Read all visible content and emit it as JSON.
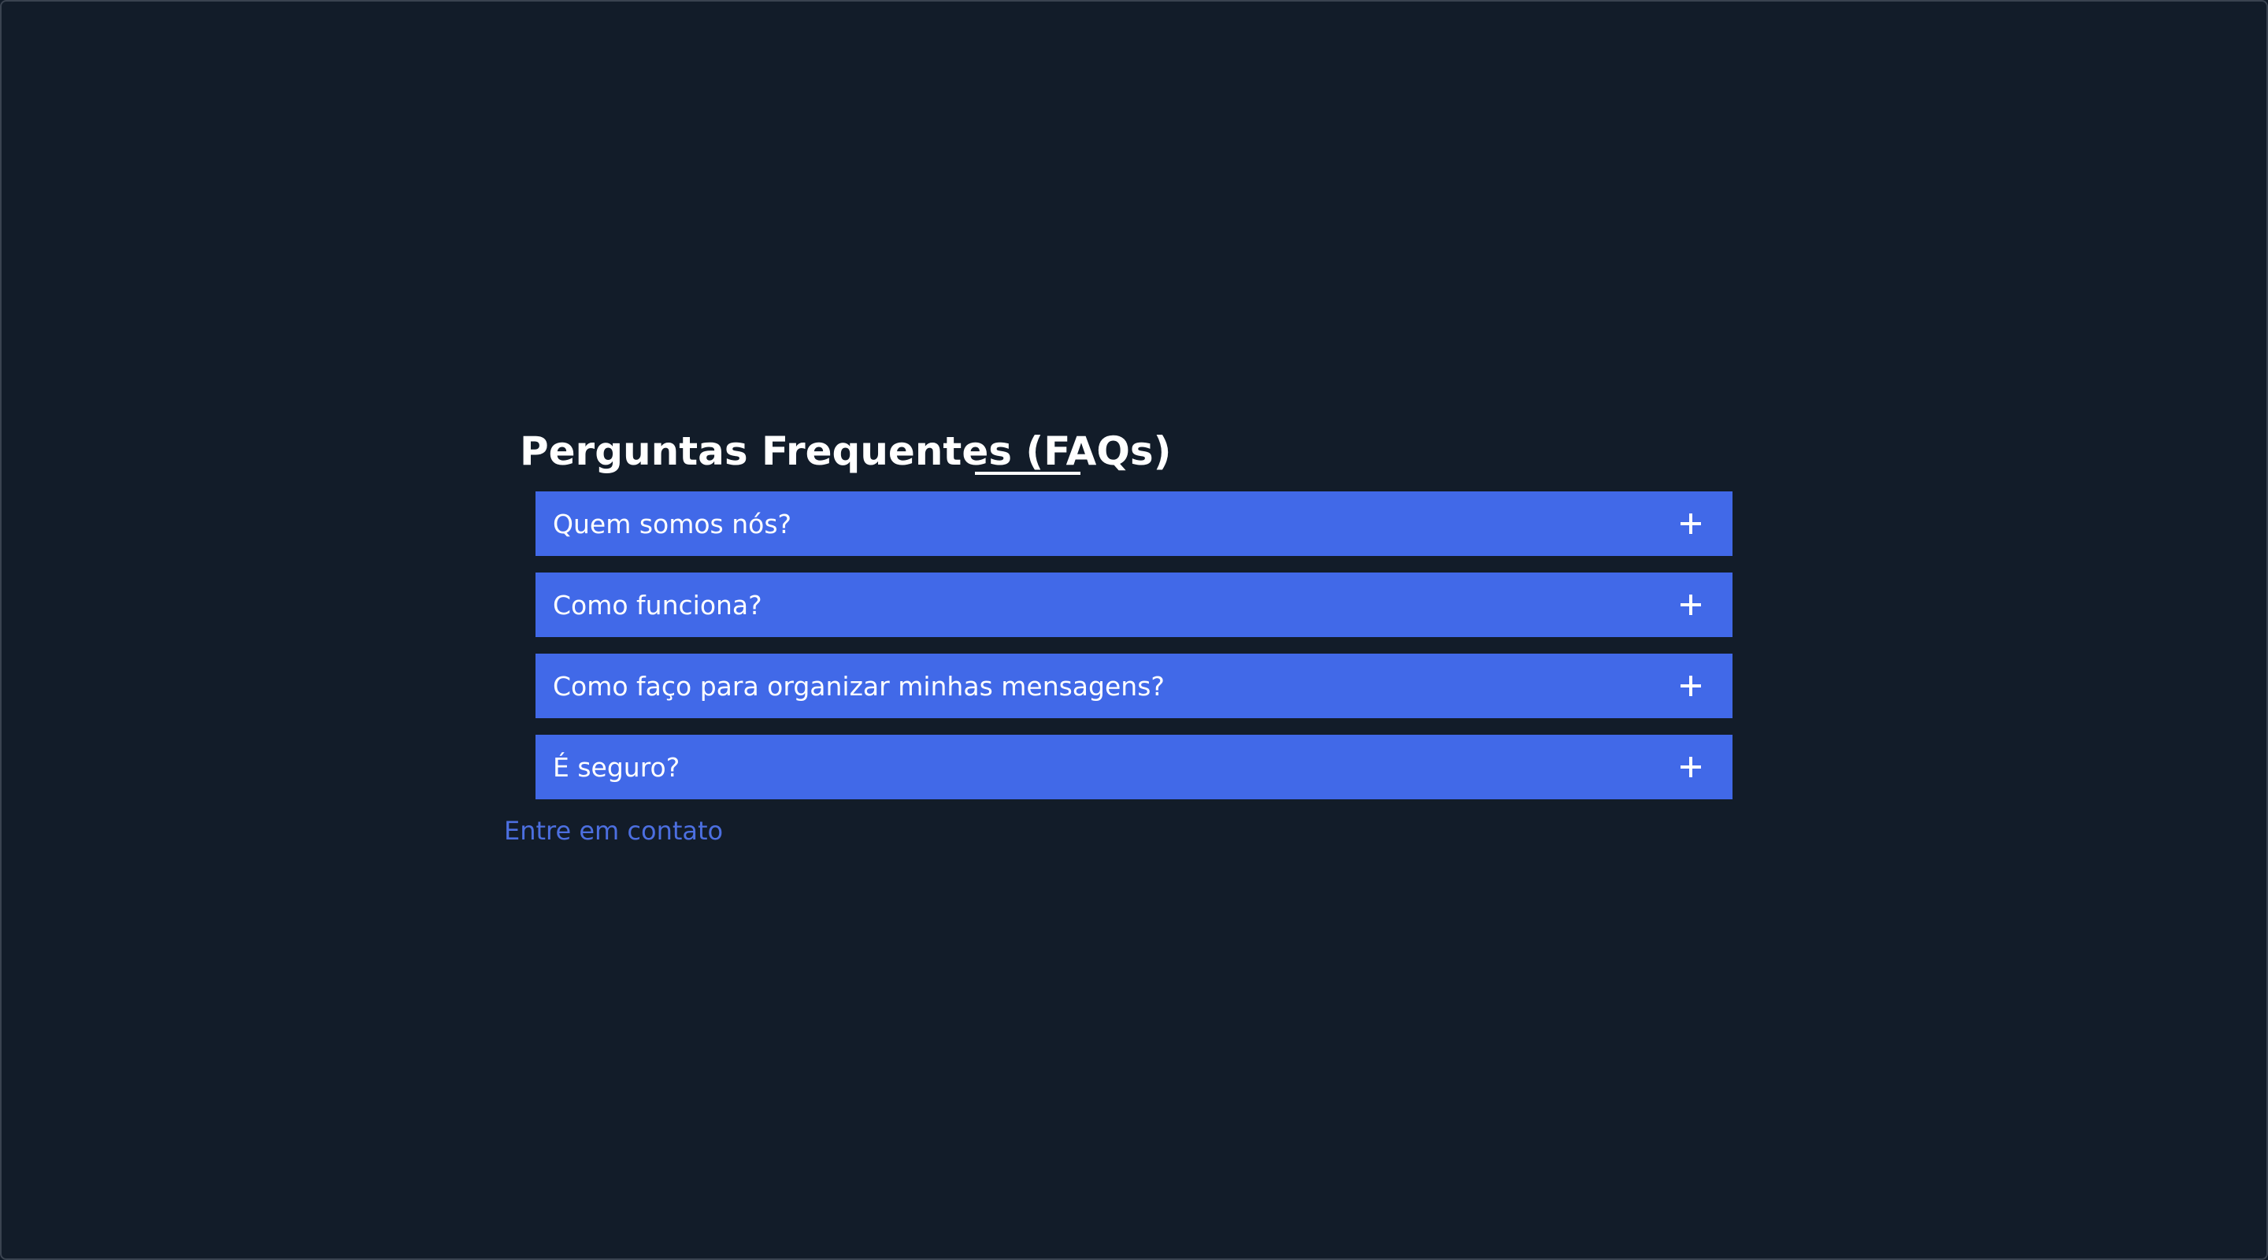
{
  "faq": {
    "title": "Perguntas Frequentes (FAQs)",
    "items": [
      {
        "question": "Quem somos nós?",
        "icon": "plus-icon"
      },
      {
        "question": "Como funciona?",
        "icon": "plus-icon"
      },
      {
        "question": "Como faço para organizar minhas mensagens?",
        "icon": "plus-icon"
      },
      {
        "question": "É seguro?",
        "icon": "plus-icon"
      }
    ],
    "contact_link": "Entre em contato"
  },
  "colors": {
    "background": "#121c29",
    "accent": "#4169e8",
    "link": "#4c6fe0",
    "text": "#ffffff"
  }
}
